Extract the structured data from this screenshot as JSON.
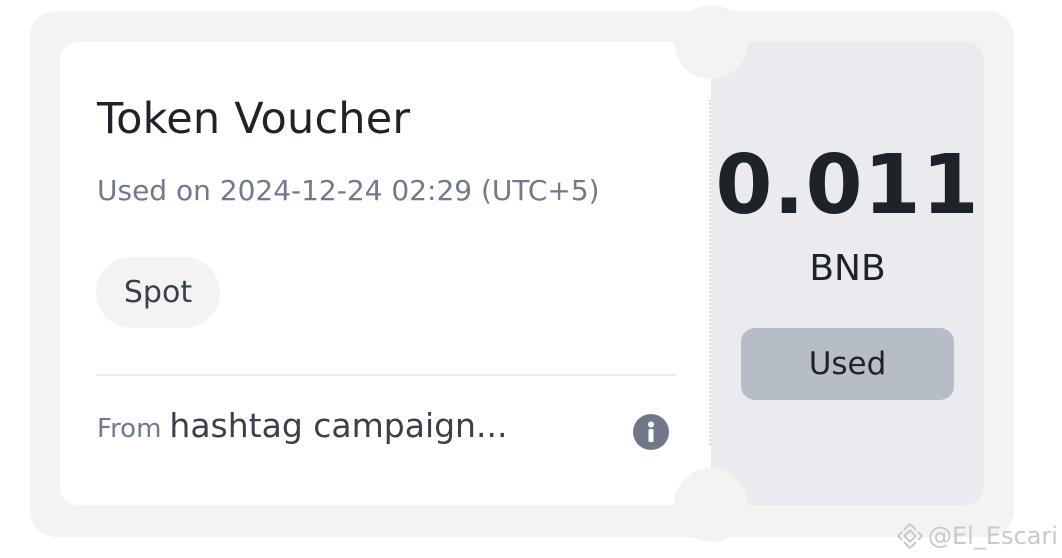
{
  "voucher": {
    "title": "Token Voucher",
    "used_on": "Used on 2024-12-24 02:29 (UTC+5)",
    "tag": "Spot",
    "from_label": "From",
    "from_value": "hashtag campaign...",
    "info_icon": "info-icon",
    "amount": "0.011",
    "currency": "BNB",
    "status_button": "Used"
  },
  "watermark": {
    "icon": "binance-logo-icon",
    "text": "@El_Escari"
  },
  "colors": {
    "background": "#f3f3f3",
    "card": "#ffffff",
    "stub": "#eaebee",
    "primary_text": "#1e2329",
    "secondary_text": "#707a8a",
    "used_button": "#b7bdc6",
    "info_icon": "#6f7788"
  }
}
